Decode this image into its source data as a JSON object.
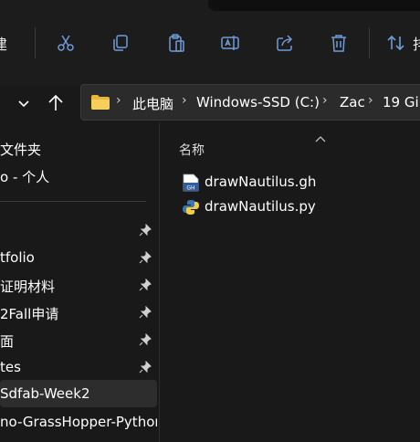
{
  "toolbar": {
    "left_clip_text": "建",
    "right_clip_text": "排",
    "icons": [
      "cut-icon",
      "copy-icon",
      "paste-icon",
      "rename-icon",
      "share-icon",
      "delete-icon",
      "sort-icon"
    ]
  },
  "address_bar": {
    "crumbs": [
      "此电脑",
      "Windows-SSD (C:)",
      "Zac",
      "19 Gi"
    ]
  },
  "sidebar": {
    "items": [
      {
        "label": "文件夹",
        "pinned": false
      },
      {
        "label": "o - 个人",
        "pinned": false
      },
      {
        "label": "",
        "pinned": true
      },
      {
        "label": "tfolio",
        "pinned": true
      },
      {
        "label": "证明材料",
        "pinned": true
      },
      {
        "label": "2Fall申请",
        "pinned": true
      },
      {
        "label": "面",
        "pinned": true
      },
      {
        "label": "tes",
        "pinned": true
      },
      {
        "label": "Sdfab-Week2",
        "pinned": false,
        "selected": true
      },
      {
        "label": "no-GrassHopper-Pythor",
        "pinned": false
      }
    ]
  },
  "content": {
    "column_header": "名称",
    "files": [
      {
        "name": "drawNautilus.gh",
        "type": "gh"
      },
      {
        "name": "drawNautilus.py",
        "type": "py"
      }
    ]
  },
  "colors": {
    "background": "#191919",
    "toolbar_bg": "#1c1c1c",
    "selected_bg": "#2d2d2d",
    "folder_yellow": "#f2c94c"
  }
}
